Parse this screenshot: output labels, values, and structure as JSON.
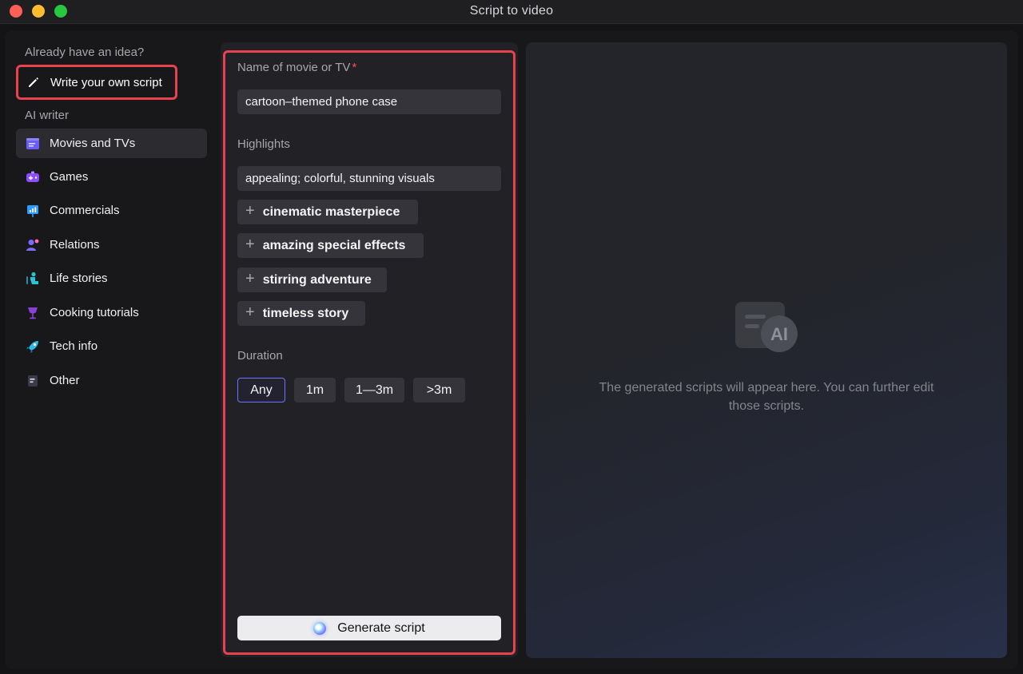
{
  "window": {
    "title": "Script to video"
  },
  "sidebar": {
    "idea_heading": "Already have an idea?",
    "write_own_label": "Write your own script",
    "ai_writer_heading": "AI writer",
    "items": [
      {
        "label": "Movies and TVs",
        "icon": "clapperboard-icon",
        "color": "#6b5cff",
        "active": true
      },
      {
        "label": "Games",
        "icon": "gamepad-icon",
        "color": "#8a4dff",
        "active": false
      },
      {
        "label": "Commercials",
        "icon": "presentation-icon",
        "color": "#2f9bff",
        "active": false
      },
      {
        "label": "Relations",
        "icon": "people-icon",
        "color": "#7b6bff",
        "active": false
      },
      {
        "label": "Life stories",
        "icon": "person-sitting-icon",
        "color": "#29c2d6",
        "active": false
      },
      {
        "label": "Cooking tutorials",
        "icon": "wine-glass-icon",
        "color": "#8a3fd9",
        "active": false
      },
      {
        "label": "Tech info",
        "icon": "rocket-icon",
        "color": "#30b8e8",
        "active": false
      },
      {
        "label": "Other",
        "icon": "document-icon",
        "color": "#c8c8d0",
        "active": false
      }
    ]
  },
  "form": {
    "name_label": "Name of movie or TV",
    "name_required_mark": "*",
    "name_value": "cartoon–themed phone case",
    "highlights_label": "Highlights",
    "highlights_value": "appealing; colorful, stunning visuals",
    "suggestions": [
      "cinematic masterpiece",
      "amazing special effects",
      "stirring adventure",
      "timeless story"
    ],
    "duration_label": "Duration",
    "durations": [
      "Any",
      "1m",
      "1—3m",
      ">3m"
    ],
    "duration_selected": "Any",
    "generate_label": "Generate script"
  },
  "result": {
    "placeholder": "The generated scripts will appear here. You can further edit those scripts.",
    "ai_badge": "AI"
  },
  "colors": {
    "highlight_outline": "#e9424f",
    "selected_accent": "#6e73ff"
  }
}
